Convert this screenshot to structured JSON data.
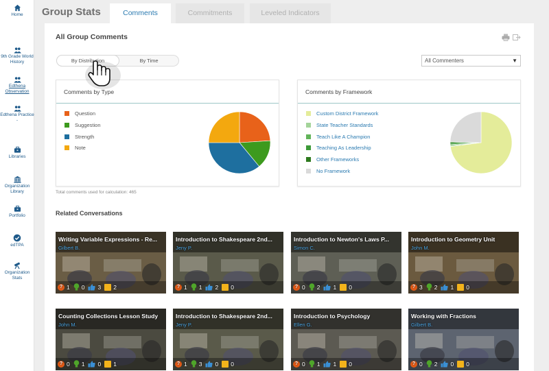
{
  "sidebar": {
    "items": [
      {
        "label": "Home",
        "icon": "home-icon"
      },
      {
        "label": "9th Grade World History",
        "icon": "group-icon"
      },
      {
        "label": "Edthena Observation",
        "icon": "group-icon"
      },
      {
        "label": "Edthena Practice -",
        "icon": "group-icon"
      },
      {
        "label": "Libraries",
        "icon": "briefcase-icon"
      },
      {
        "label": "Organization Library",
        "icon": "institution-icon"
      },
      {
        "label": "Portfolio",
        "icon": "briefcase-icon"
      },
      {
        "label": "edTPA",
        "icon": "badge-check-icon"
      },
      {
        "label": "Organization Stats",
        "icon": "telescope-icon"
      }
    ]
  },
  "header": {
    "title": "Group Stats",
    "tabs": [
      {
        "label": "Comments",
        "active": true
      },
      {
        "label": "Commitments",
        "active": false
      },
      {
        "label": "Leveled Indicators",
        "active": false
      }
    ]
  },
  "main": {
    "section_title": "All Group Comments",
    "toggle": {
      "distribution": "By Distribution",
      "time": "By Time",
      "selected": "By Distribution"
    },
    "commenter_filter": "All Commenters",
    "total_note": "Total comments used for calculation: 465",
    "related_title": "Related Conversations"
  },
  "chart_data": [
    {
      "type": "pie",
      "title": "Comments by Type",
      "categories": [
        "Question",
        "Suggestion",
        "Strength",
        "Note"
      ],
      "values": [
        24,
        15,
        36,
        25
      ],
      "colors": [
        "#e8621a",
        "#3d9a1e",
        "#1e6f9f",
        "#f3a80f"
      ]
    },
    {
      "type": "pie",
      "title": "Comments by Framework",
      "categories": [
        "Custom District Framework",
        "State Teacher Standards",
        "Teach Like A Champion",
        "Teaching As Leadership",
        "Other Frameworks",
        "No Framework"
      ],
      "values": [
        73,
        0.5,
        0.5,
        1,
        0.5,
        24.5
      ],
      "colors": [
        "#e4ec9a",
        "#a4d49a",
        "#62b45a",
        "#3d9a38",
        "#2d7a1e",
        "#dadada"
      ]
    }
  ],
  "conversations": [
    {
      "title": "Writing Variable Expressions - Re...",
      "author": "Gilbert B.",
      "questions": "1",
      "suggestions": "0",
      "strengths": "3",
      "notes": "2",
      "tone": "#6a5d45"
    },
    {
      "title": "Introduction to Shakespeare 2nd...",
      "author": "Jeny P.",
      "questions": "1",
      "suggestions": "1",
      "strengths": "2",
      "notes": "0",
      "tone": "#5a5a4a"
    },
    {
      "title": "Introduction to Newton's Laws P...",
      "author": "Simon C.",
      "questions": "0",
      "suggestions": "2",
      "strengths": "1",
      "notes": "0",
      "tone": "#5e5f55"
    },
    {
      "title": "Introduction to Geometry Unit",
      "author": "John M.",
      "questions": "3",
      "suggestions": "2",
      "strengths": "1",
      "notes": "0",
      "tone": "#6b5a3f"
    },
    {
      "title": "Counting Collections Lesson Study",
      "author": "John M.",
      "questions": "0",
      "suggestions": "1",
      "strengths": "0",
      "notes": "1",
      "tone": "#4b4a40"
    },
    {
      "title": "Introduction to Shakespeare 2nd...",
      "author": "Jeny P.",
      "questions": "1",
      "suggestions": "3",
      "strengths": "0",
      "notes": "0",
      "tone": "#5a5a4a"
    },
    {
      "title": "Introduction to Psychology",
      "author": "Ellen G.",
      "questions": "0",
      "suggestions": "1",
      "strengths": "1",
      "notes": "0",
      "tone": "#5c5a52"
    },
    {
      "title": "Working with Fractions",
      "author": "Gilbert B.",
      "questions": "0",
      "suggestions": "2",
      "strengths": "0",
      "notes": "0",
      "tone": "#5d6470"
    }
  ],
  "colors": {
    "accent": "#2a7ab0",
    "link": "#1e5a8a",
    "rule": "#9cc7c7"
  }
}
